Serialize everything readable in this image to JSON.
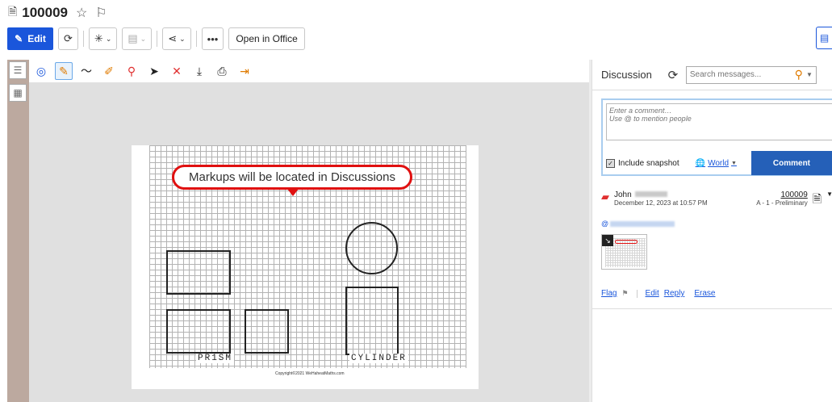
{
  "title": {
    "text": "100009"
  },
  "toolbar": {
    "edit_label": "Edit",
    "open_office_label": "Open in Office"
  },
  "markup": {
    "bubble_text": "Markups will be located in Discussions",
    "label_prism": "PR1SM",
    "label_cylinder": "CYLINDER",
    "copyright": "Copyright©2021 WeHaheatMaths.com"
  },
  "discussion": {
    "title": "Discussion",
    "search_placeholder": "Search messages...",
    "comment_placeholder": "Enter a comment…\nUse @ to mention people",
    "include_snapshot": "Include snapshot",
    "visibility": "World",
    "comment_button": "Comment",
    "message": {
      "author": "John",
      "date": "December 12, 2023 at 10:57 PM",
      "doc_number": "100009",
      "doc_status": "A - 1 - Preliminary",
      "mention_prefix": "@"
    },
    "actions": {
      "flag": "Flag",
      "edit": "Edit",
      "reply": "Reply",
      "erase": "Erase"
    }
  },
  "colors": {
    "accent": "#1a56db",
    "markup_red": "#e01010",
    "comment_button": "#2560b8"
  }
}
